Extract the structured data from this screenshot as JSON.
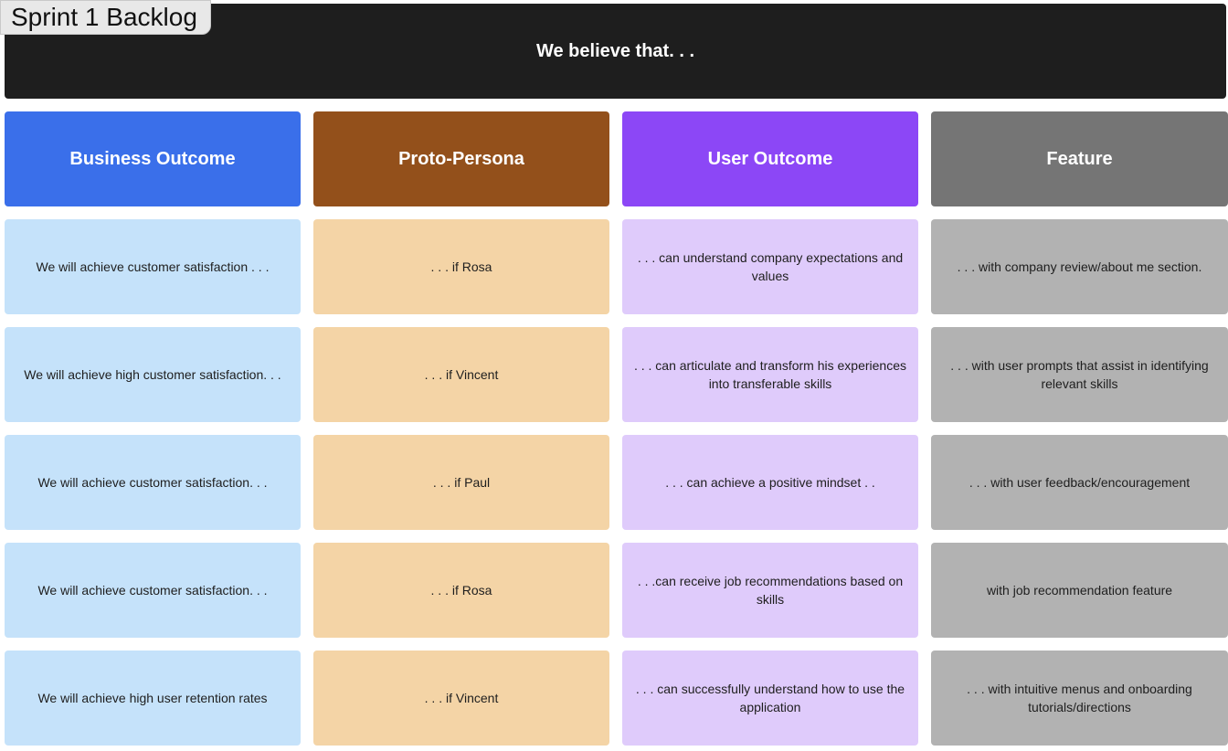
{
  "frame": {
    "title": "Sprint 1 Backlog"
  },
  "banner": {
    "text": "We believe that. . ."
  },
  "columns": [
    {
      "header": "Business Outcome",
      "cards": [
        "We will achieve customer satisfaction . . .",
        "We will achieve high customer satisfaction. . .",
        "We will achieve customer satisfaction. . .",
        "We will achieve customer satisfaction. . .",
        "We will achieve high user retention rates"
      ]
    },
    {
      "header": "Proto-Persona",
      "cards": [
        ". . . if Rosa",
        ". . . if Vincent",
        ". . . if Paul",
        ". . . if Rosa",
        ". . . if Vincent"
      ]
    },
    {
      "header": "User Outcome",
      "cards": [
        ". . . can understand company expectations and values",
        ". . . can articulate and transform his experiences into transferable skills",
        ". . . can achieve a positive mindset . .",
        ". . .can receive job recommendations based on skills",
        ". . . can successfully understand how to use the application"
      ]
    },
    {
      "header": "Feature",
      "cards": [
        ". . . with company review/about me section.",
        ". . . with user prompts that assist in identifying relevant skills",
        ". . . with user feedback/encouragement",
        "with job recommendation feature",
        ". . . with intuitive menus and onboarding tutorials/directions"
      ]
    }
  ],
  "colors": {
    "business_header": "#3a6fea",
    "persona_header": "#93501b",
    "user_header": "#8c47f6",
    "feature_header": "#757575",
    "business_card": "#c5e2fa",
    "persona_card": "#f4d4a6",
    "user_card": "#dfcbfb",
    "feature_card": "#b2b2b2",
    "banner": "#1e1e1e"
  }
}
